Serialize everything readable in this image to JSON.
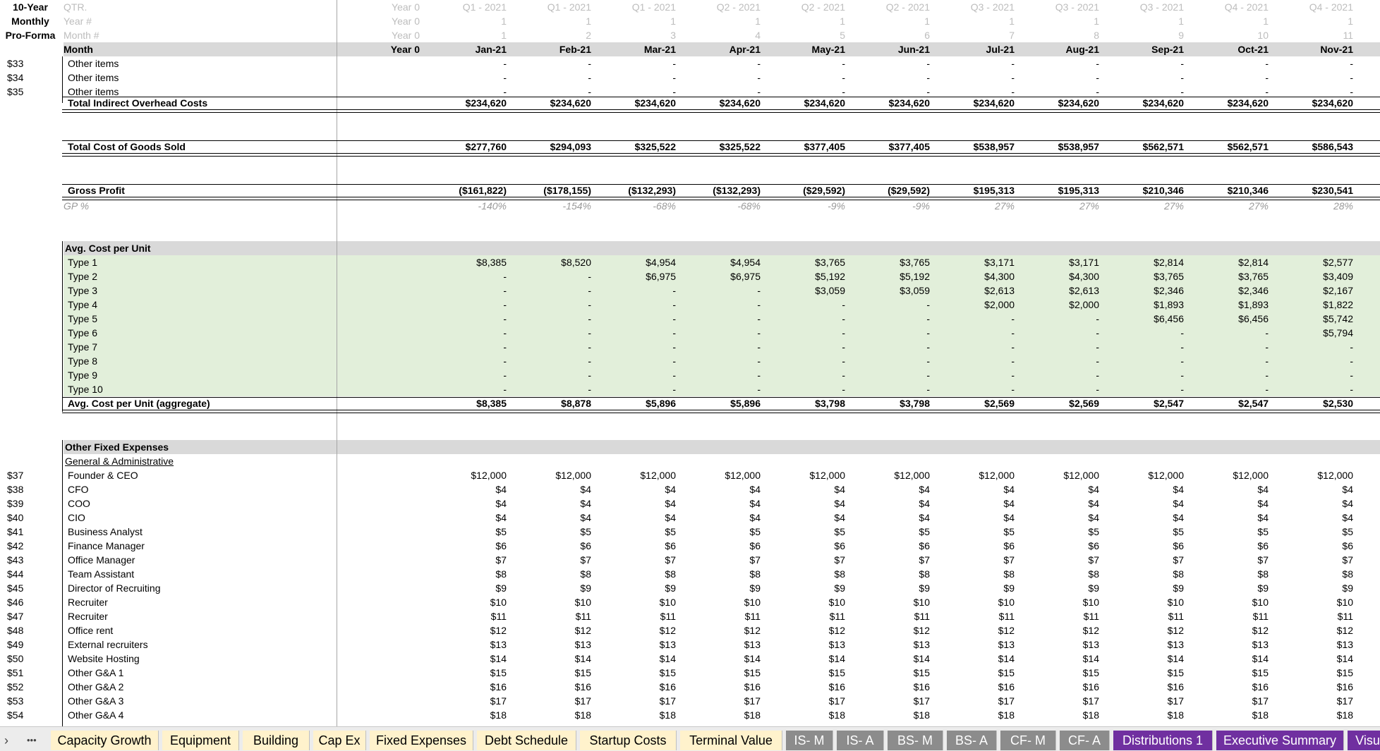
{
  "header": {
    "title_lines": [
      "10-Year",
      "Monthly",
      "Pro-Forma"
    ],
    "row_labels": [
      "QTR.",
      "Year #",
      "Month #",
      "Month"
    ],
    "year0": {
      "qtr": "Year 0",
      "year": "Year 0",
      "month_num": "Year 0",
      "month": "Year 0"
    },
    "columns": [
      {
        "qtr": "Q1 - 2021",
        "year": "1",
        "month_num": "1",
        "month": "Jan-21"
      },
      {
        "qtr": "Q1 - 2021",
        "year": "1",
        "month_num": "2",
        "month": "Feb-21"
      },
      {
        "qtr": "Q1 - 2021",
        "year": "1",
        "month_num": "3",
        "month": "Mar-21"
      },
      {
        "qtr": "Q2 - 2021",
        "year": "1",
        "month_num": "4",
        "month": "Apr-21"
      },
      {
        "qtr": "Q2 - 2021",
        "year": "1",
        "month_num": "5",
        "month": "May-21"
      },
      {
        "qtr": "Q2 - 2021",
        "year": "1",
        "month_num": "6",
        "month": "Jun-21"
      },
      {
        "qtr": "Q3 - 2021",
        "year": "1",
        "month_num": "7",
        "month": "Jul-21"
      },
      {
        "qtr": "Q3 - 2021",
        "year": "1",
        "month_num": "8",
        "month": "Aug-21"
      },
      {
        "qtr": "Q3 - 2021",
        "year": "1",
        "month_num": "9",
        "month": "Sep-21"
      },
      {
        "qtr": "Q4 - 2021",
        "year": "1",
        "month_num": "10",
        "month": "Oct-21"
      },
      {
        "qtr": "Q4 - 2021",
        "year": "1",
        "month_num": "11",
        "month": "Nov-21"
      }
    ]
  },
  "overhead": {
    "rows": [
      {
        "ref": "$33",
        "label": "Other items",
        "values": [
          "-",
          "-",
          "-",
          "-",
          "-",
          "-",
          "-",
          "-",
          "-",
          "-",
          "-"
        ]
      },
      {
        "ref": "$34",
        "label": "Other items",
        "values": [
          "-",
          "-",
          "-",
          "-",
          "-",
          "-",
          "-",
          "-",
          "-",
          "-",
          "-"
        ]
      },
      {
        "ref": "$35",
        "label": "Other items",
        "values": [
          "-",
          "-",
          "-",
          "-",
          "-",
          "-",
          "-",
          "-",
          "-",
          "-",
          "-"
        ]
      }
    ],
    "total": {
      "label": "Total Indirect Overhead Costs",
      "values": [
        "$234,620",
        "$234,620",
        "$234,620",
        "$234,620",
        "$234,620",
        "$234,620",
        "$234,620",
        "$234,620",
        "$234,620",
        "$234,620",
        "$234,620"
      ]
    }
  },
  "cogs": {
    "label": "Total Cost of Goods Sold",
    "values": [
      "$277,760",
      "$294,093",
      "$325,522",
      "$325,522",
      "$377,405",
      "$377,405",
      "$538,957",
      "$538,957",
      "$562,571",
      "$562,571",
      "$586,543"
    ]
  },
  "gross_profit": {
    "label": "Gross Profit",
    "values": [
      "($161,822)",
      "($178,155)",
      "($132,293)",
      "($132,293)",
      "($29,592)",
      "($29,592)",
      "$195,313",
      "$195,313",
      "$210,346",
      "$210,346",
      "$230,541"
    ],
    "gp_label": "GP %",
    "gp_values": [
      "-140%",
      "-154%",
      "-68%",
      "-68%",
      "-9%",
      "-9%",
      "27%",
      "27%",
      "27%",
      "27%",
      "28%"
    ]
  },
  "avg_cost": {
    "title": "Avg. Cost per Unit",
    "rows": [
      {
        "label": "Type 1",
        "values": [
          "$8,385",
          "$8,520",
          "$4,954",
          "$4,954",
          "$3,765",
          "$3,765",
          "$3,171",
          "$3,171",
          "$2,814",
          "$2,814",
          "$2,577"
        ]
      },
      {
        "label": "Type 2",
        "values": [
          "-",
          "-",
          "$6,975",
          "$6,975",
          "$5,192",
          "$5,192",
          "$4,300",
          "$4,300",
          "$3,765",
          "$3,765",
          "$3,409"
        ]
      },
      {
        "label": "Type 3",
        "values": [
          "-",
          "-",
          "-",
          "-",
          "$3,059",
          "$3,059",
          "$2,613",
          "$2,613",
          "$2,346",
          "$2,346",
          "$2,167"
        ]
      },
      {
        "label": "Type 4",
        "values": [
          "-",
          "-",
          "-",
          "-",
          "-",
          "-",
          "$2,000",
          "$2,000",
          "$1,893",
          "$1,893",
          "$1,822"
        ]
      },
      {
        "label": "Type 5",
        "values": [
          "-",
          "-",
          "-",
          "-",
          "-",
          "-",
          "-",
          "-",
          "$6,456",
          "$6,456",
          "$5,742"
        ]
      },
      {
        "label": "Type 6",
        "values": [
          "-",
          "-",
          "-",
          "-",
          "-",
          "-",
          "-",
          "-",
          "-",
          "-",
          "$5,794"
        ]
      },
      {
        "label": "Type 7",
        "values": [
          "-",
          "-",
          "-",
          "-",
          "-",
          "-",
          "-",
          "-",
          "-",
          "-",
          "-"
        ]
      },
      {
        "label": "Type 8",
        "values": [
          "-",
          "-",
          "-",
          "-",
          "-",
          "-",
          "-",
          "-",
          "-",
          "-",
          "-"
        ]
      },
      {
        "label": "Type 9",
        "values": [
          "-",
          "-",
          "-",
          "-",
          "-",
          "-",
          "-",
          "-",
          "-",
          "-",
          "-"
        ]
      },
      {
        "label": "Type 10",
        "values": [
          "-",
          "-",
          "-",
          "-",
          "-",
          "-",
          "-",
          "-",
          "-",
          "-",
          "-"
        ]
      }
    ],
    "aggregate": {
      "label": "Avg. Cost per Unit (aggregate)",
      "values": [
        "$8,385",
        "$8,878",
        "$5,896",
        "$5,896",
        "$3,798",
        "$3,798",
        "$2,569",
        "$2,569",
        "$2,547",
        "$2,547",
        "$2,530"
      ]
    }
  },
  "fixed": {
    "title": "Other Fixed Expenses",
    "subtitle": "General & Administrative",
    "rows": [
      {
        "ref": "$37",
        "label": "Founder & CEO",
        "value": "$12,000"
      },
      {
        "ref": "$38",
        "label": "CFO",
        "value": "$4"
      },
      {
        "ref": "$39",
        "label": "COO",
        "value": "$4"
      },
      {
        "ref": "$40",
        "label": "CIO",
        "value": "$4"
      },
      {
        "ref": "$41",
        "label": "Business Analyst",
        "value": "$5"
      },
      {
        "ref": "$42",
        "label": "Finance Manager",
        "value": "$6"
      },
      {
        "ref": "$43",
        "label": "Office Manager",
        "value": "$7"
      },
      {
        "ref": "$44",
        "label": "Team Assistant",
        "value": "$8"
      },
      {
        "ref": "$45",
        "label": "Director of Recruiting",
        "value": "$9"
      },
      {
        "ref": "$46",
        "label": "Recruiter",
        "value": "$10"
      },
      {
        "ref": "$47",
        "label": "Recruiter",
        "value": "$11"
      },
      {
        "ref": "$48",
        "label": "Office rent",
        "value": "$12"
      },
      {
        "ref": "$49",
        "label": "External recruiters",
        "value": "$13"
      },
      {
        "ref": "$50",
        "label": "Website Hosting",
        "value": "$14"
      },
      {
        "ref": "$51",
        "label": "Other G&A 1",
        "value": "$15"
      },
      {
        "ref": "$52",
        "label": "Other G&A 2",
        "value": "$16"
      },
      {
        "ref": "$53",
        "label": "Other G&A 3",
        "value": "$17"
      },
      {
        "ref": "$54",
        "label": "Other G&A 4",
        "value": "$18"
      }
    ]
  },
  "tabs": {
    "nav_prev": "›",
    "nav_more": "•••",
    "items": [
      {
        "label": "Capacity Growth",
        "style": "y"
      },
      {
        "label": "Equipment",
        "style": "y"
      },
      {
        "label": "Building",
        "style": "y"
      },
      {
        "label": "Cap Ex",
        "style": "y"
      },
      {
        "label": "Fixed Expenses",
        "style": "y"
      },
      {
        "label": "Debt Schedule",
        "style": "y"
      },
      {
        "label": "Startup Costs",
        "style": "y"
      },
      {
        "label": "Terminal Value",
        "style": "y"
      },
      {
        "label": "IS- M",
        "style": "g"
      },
      {
        "label": "IS- A",
        "style": "g"
      },
      {
        "label": "BS- M",
        "style": "g"
      },
      {
        "label": "BS- A",
        "style": "g"
      },
      {
        "label": "CF- M",
        "style": "g"
      },
      {
        "label": "CF- A",
        "style": "g"
      },
      {
        "label": "Distributions 1",
        "style": "p"
      },
      {
        "label": "Executive Summary",
        "style": "p"
      },
      {
        "label": "Visuals",
        "style": "p"
      }
    ]
  }
}
